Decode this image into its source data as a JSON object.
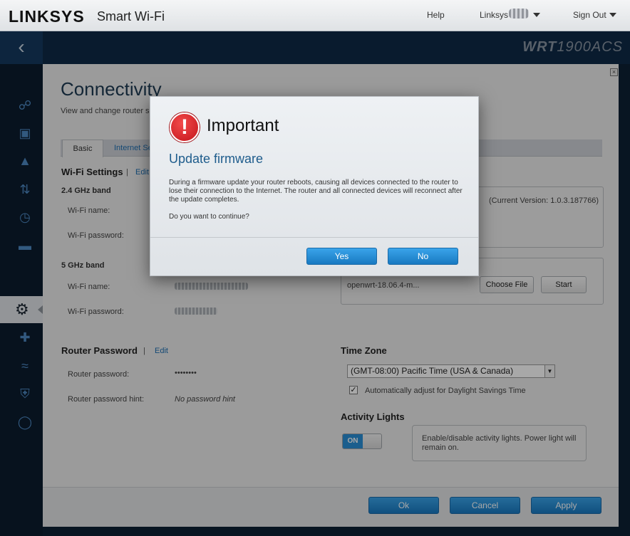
{
  "topbar": {
    "brand": "LINKSYS",
    "brand_sub": "Smart Wi-Fi",
    "help": "Help",
    "user": "Linksys",
    "signout": "Sign Out"
  },
  "header": {
    "back_icon": "chevron-left-icon",
    "model_bold": "WRT",
    "model_rest": "1900ACS"
  },
  "sidebar": {
    "items": [
      {
        "icon": "network-map-icon"
      },
      {
        "icon": "device-list-icon"
      },
      {
        "icon": "warning-icon"
      },
      {
        "icon": "media-prioritization-icon"
      },
      {
        "icon": "speed-test-icon"
      },
      {
        "icon": "external-storage-icon"
      },
      {
        "icon": "gear-icon",
        "active": true
      },
      {
        "icon": "troubleshooting-icon"
      },
      {
        "icon": "wireless-icon"
      },
      {
        "icon": "security-icon"
      },
      {
        "icon": "openvpn-icon"
      }
    ]
  },
  "page": {
    "title": "Connectivity",
    "subtitle": "View and change router se",
    "tabs": [
      "Basic",
      "Internet Se"
    ]
  },
  "wifi": {
    "heading": "Wi-Fi Settings",
    "sep": "|",
    "edit": "Edit",
    "band24": "2.4 GHz band",
    "band5": "5 GHz band",
    "name_label": "Wi-Fi name:",
    "password_label": "Wi-Fi password:"
  },
  "router_password": {
    "heading": "Router Password",
    "sep": "|",
    "edit": "Edit",
    "password_label": "Router password:",
    "password_value": "••••••••",
    "hint_label": "Router password hint:",
    "hint_value": "No password hint"
  },
  "firmware": {
    "current_version": "(Current Version: 1.0.3.187766)",
    "file_name": "openwrt-18.06.4-m...",
    "choose_file": "Choose File",
    "start": "Start"
  },
  "timezone": {
    "heading": "Time Zone",
    "selected": "(GMT-08:00) Pacific Time (USA & Canada)",
    "dst_label": "Automatically adjust for Daylight Savings Time",
    "dst_checked": true
  },
  "activity_lights": {
    "heading": "Activity Lights",
    "toggle": "ON",
    "description": "Enable/disable activity lights. Power light will remain on."
  },
  "footer": {
    "ok": "Ok",
    "cancel": "Cancel",
    "apply": "Apply"
  },
  "modal": {
    "icon": "alert-exclamation-icon",
    "title": "Important",
    "subtitle": "Update firmware",
    "body": "During a firmware update your router reboots, causing all devices connected to the router to lose their connection to the Internet. The router and all connected devices will reconnect after the update completes.",
    "question": "Do you want to continue?",
    "yes": "Yes",
    "no": "No"
  }
}
